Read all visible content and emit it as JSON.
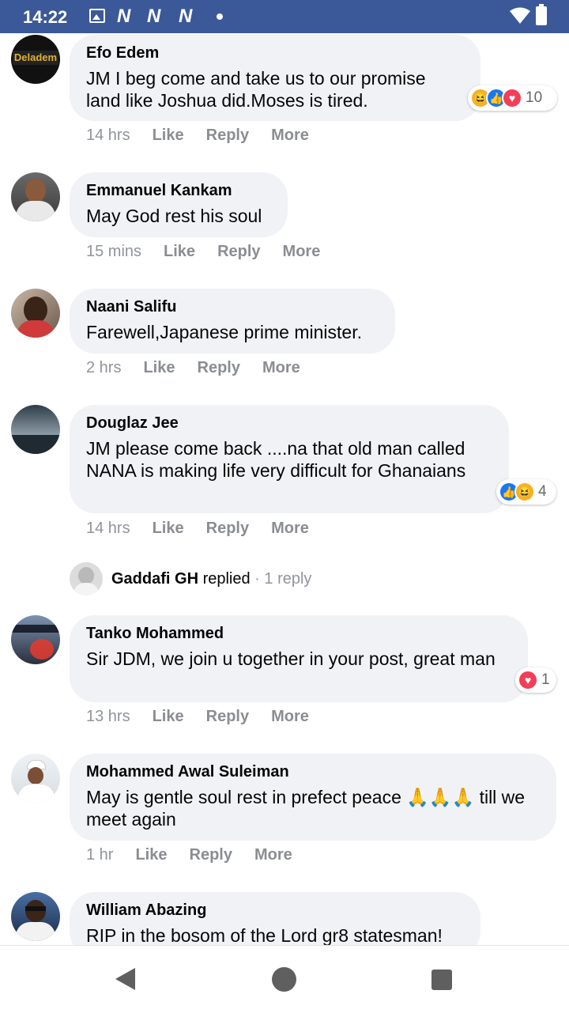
{
  "status_bar": {
    "time": "14:22",
    "notification_letters": [
      "N",
      "N",
      "N"
    ],
    "icons": [
      "image-icon",
      "wifi-icon",
      "battery-icon"
    ],
    "background": "#3b5998"
  },
  "comments": [
    {
      "name": "Efo Edem",
      "avatar_text": "Deladem",
      "text": "JM I beg come and take us to our promise land like Joshua did.Moses is tired.",
      "time": "14 hrs",
      "reactions": [
        "haha",
        "like",
        "love"
      ],
      "reaction_count": "10"
    },
    {
      "name": "Emmanuel Kankam",
      "text": "May God rest his soul",
      "time": "15 mins"
    },
    {
      "name": "Naani Salifu",
      "text": "Farewell,Japanese prime minister.",
      "time": "2 hrs"
    },
    {
      "name": "Douglaz Jee",
      "text": "JM please come back ....na that old man called NANA is making life very difficult for Ghanaians",
      "time": "14 hrs",
      "reactions": [
        "like",
        "haha"
      ],
      "reaction_count": "4"
    },
    {
      "name": "Tanko Mohammed",
      "text": "Sir JDM, we join u together in your post, great man",
      "time": "13 hrs",
      "reactions": [
        "love"
      ],
      "reaction_count": "1"
    },
    {
      "name": "Mohammed Awal Suleiman",
      "text": "May is gentle soul rest in prefect peace 🙏🙏🙏 till we meet again",
      "time": "1 hr"
    },
    {
      "name": "William Abazing",
      "text": "RIP in the bosom of the Lord gr8 statesman!"
    }
  ],
  "actions": {
    "like": "Like",
    "reply": "Reply",
    "more": "More"
  },
  "reply_summary": {
    "name": "Gaddafi GH",
    "verb": "replied",
    "meta": " · 1 reply"
  },
  "colors": {
    "bubble": "#f0f2f5",
    "meta_text": "#90949c",
    "like": "#1877f2",
    "love": "#f33e58",
    "haha": "#f7b125"
  }
}
